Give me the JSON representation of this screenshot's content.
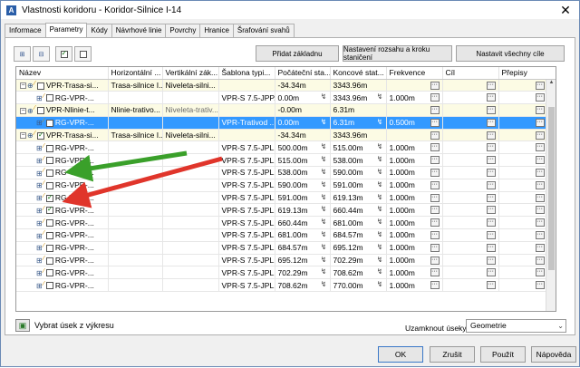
{
  "window": {
    "title": "Vlastnosti koridoru - Koridor-Silnice I-14",
    "app_icon_letter": "A",
    "close_glyph": "✕"
  },
  "tabs": [
    {
      "label": "Informace",
      "active": false
    },
    {
      "label": "Parametry",
      "active": true
    },
    {
      "label": "Kódy",
      "active": false
    },
    {
      "label": "Návrhové linie",
      "active": false
    },
    {
      "label": "Povrchy",
      "active": false
    },
    {
      "label": "Hranice",
      "active": false
    },
    {
      "label": "Šrafování svahů",
      "active": false
    }
  ],
  "toolbar": {
    "btn_add_baseline": "Přidat základnu",
    "btn_set_region": "Nastavení rozsahu a kroku staničení",
    "btn_set_targets": "Nastavit všechny cíle"
  },
  "columns": [
    "Název",
    "Horizontální ...",
    "Vertikální zák...",
    "Šablona typi...",
    "Počáteční sta...",
    "Koncové stat...",
    "Frekvence",
    "Cíl",
    "Přepisy"
  ],
  "rows": [
    {
      "type": "group",
      "level": 0,
      "checked": false,
      "name": "VPR-Trasa-si...",
      "horiz": "Trasa-silnice I...",
      "vert": "Niveleta-silni...",
      "assembly": "",
      "start": "-34.34m",
      "end": "3343.96m",
      "freq": "",
      "target_btn": true,
      "override_btn": true
    },
    {
      "type": "region",
      "level": 1,
      "checked": false,
      "name": "RG-VPR-...",
      "horiz": "",
      "vert": "",
      "assembly": "VPR-S 7.5-JPP...",
      "start": "0.00m",
      "end": "3343.96m",
      "freq": "1.000m",
      "target_btn": true,
      "override_btn": true
    },
    {
      "type": "group",
      "level": 0,
      "checked": false,
      "name": "VPR-Nlinie-t...",
      "horiz": "Nlinie-trativo...",
      "vert": "Niveleta-trativ...",
      "assembly": "",
      "start": "-0.00m",
      "end": "6.31m",
      "freq": "",
      "target_btn": true,
      "override_btn": true,
      "vert_dim": true
    },
    {
      "type": "selected",
      "level": 1,
      "checked": false,
      "name": "RG-VPR-...",
      "horiz": "",
      "vert": "",
      "assembly": "VPR-Trativod ...",
      "start": "0.00m",
      "end": "6.31m",
      "freq": "0.500m",
      "target_btn": true,
      "override_btn": true
    },
    {
      "type": "group",
      "level": 0,
      "checked": true,
      "name": "VPR-Trasa-si...",
      "horiz": "Trasa-silnice I...",
      "vert": "Niveleta-silni...",
      "assembly": "",
      "start": "-34.34m",
      "end": "3343.96m",
      "freq": "",
      "target_btn": true,
      "override_btn": true
    },
    {
      "type": "region",
      "level": 1,
      "checked": false,
      "name": "RG-VPR-...",
      "horiz": "",
      "vert": "",
      "assembly": "VPR-S 7.5-JPL...",
      "start": "500.00m",
      "end": "515.00m",
      "freq": "1.000m",
      "target_btn": true,
      "override_btn": true
    },
    {
      "type": "region",
      "level": 1,
      "checked": false,
      "name": "RG-VPR-...",
      "horiz": "",
      "vert": "",
      "assembly": "VPR-S 7.5-JPL...",
      "start": "515.00m",
      "end": "538.00m",
      "freq": "1.000m",
      "target_btn": true,
      "override_btn": true
    },
    {
      "type": "region",
      "level": 1,
      "checked": false,
      "name": "RG-VPR-...",
      "horiz": "",
      "vert": "",
      "assembly": "VPR-S 7.5-JPL...",
      "start": "538.00m",
      "end": "590.00m",
      "freq": "1.000m",
      "target_btn": true,
      "override_btn": true
    },
    {
      "type": "region",
      "level": 1,
      "checked": false,
      "name": "RG-VPR-...",
      "horiz": "",
      "vert": "",
      "assembly": "VPR-S 7.5-JPL...",
      "start": "590.00m",
      "end": "591.00m",
      "freq": "1.000m",
      "target_btn": true,
      "override_btn": true
    },
    {
      "type": "region",
      "level": 1,
      "checked": true,
      "name": "RG-VPR-...",
      "horiz": "",
      "vert": "",
      "assembly": "VPR-S 7.5-JPL...",
      "start": "591.00m",
      "end": "619.13m",
      "freq": "1.000m",
      "target_btn": true,
      "override_btn": true
    },
    {
      "type": "region",
      "level": 1,
      "checked": true,
      "name": "RG-VPR-...",
      "horiz": "",
      "vert": "",
      "assembly": "VPR-S 7.5-JPL...",
      "start": "619.13m",
      "end": "660.44m",
      "freq": "1.000m",
      "target_btn": true,
      "override_btn": true
    },
    {
      "type": "region",
      "level": 1,
      "checked": false,
      "name": "RG-VPR-...",
      "horiz": "",
      "vert": "",
      "assembly": "VPR-S 7.5-JPL...",
      "start": "660.44m",
      "end": "681.00m",
      "freq": "1.000m",
      "target_btn": true,
      "override_btn": true
    },
    {
      "type": "region",
      "level": 1,
      "checked": false,
      "name": "RG-VPR-...",
      "horiz": "",
      "vert": "",
      "assembly": "VPR-S 7.5-JPL...",
      "start": "681.00m",
      "end": "684.57m",
      "freq": "1.000m",
      "target_btn": true,
      "override_btn": true
    },
    {
      "type": "region",
      "level": 1,
      "checked": false,
      "name": "RG-VPR-...",
      "horiz": "",
      "vert": "",
      "assembly": "VPR-S 7.5-JPL...",
      "start": "684.57m",
      "end": "695.12m",
      "freq": "1.000m",
      "target_btn": true,
      "override_btn": true
    },
    {
      "type": "region",
      "level": 1,
      "checked": false,
      "name": "RG-VPR-...",
      "horiz": "",
      "vert": "",
      "assembly": "VPR-S 7.5-JPL...",
      "start": "695.12m",
      "end": "702.29m",
      "freq": "1.000m",
      "target_btn": true,
      "override_btn": true
    },
    {
      "type": "region",
      "level": 1,
      "checked": false,
      "name": "RG-VPR-...",
      "horiz": "",
      "vert": "",
      "assembly": "VPR-S 7.5-JPL...",
      "start": "702.29m",
      "end": "708.62m",
      "freq": "1.000m",
      "target_btn": true,
      "override_btn": true
    },
    {
      "type": "region",
      "level": 1,
      "checked": false,
      "name": "RG-VPR-...",
      "horiz": "",
      "vert": "",
      "assembly": "VPR-S 7.5-JPL...",
      "start": "708.62m",
      "end": "770.00m",
      "freq": "1.000m",
      "target_btn": true,
      "override_btn": true
    }
  ],
  "bottom": {
    "pick_label": "Vybrat úsek z výkresu",
    "lock_label": "Uzamknout úseky k:",
    "lock_value": "Geometrie"
  },
  "footer": {
    "ok": "OK",
    "cancel": "Zrušit",
    "apply": "Použít",
    "help": "Nápověda"
  },
  "colors": {
    "group_row_bg": "#fcfbe4",
    "selected_bg": "#3399ff",
    "green_arrow": "#3aa02a",
    "red_arrow": "#e0352b"
  },
  "icons": {
    "expand": "−",
    "baseline": "⊕",
    "region": "⊞",
    "ellipsis": "···",
    "station_pick": "↯",
    "dropdown": "⌄"
  }
}
